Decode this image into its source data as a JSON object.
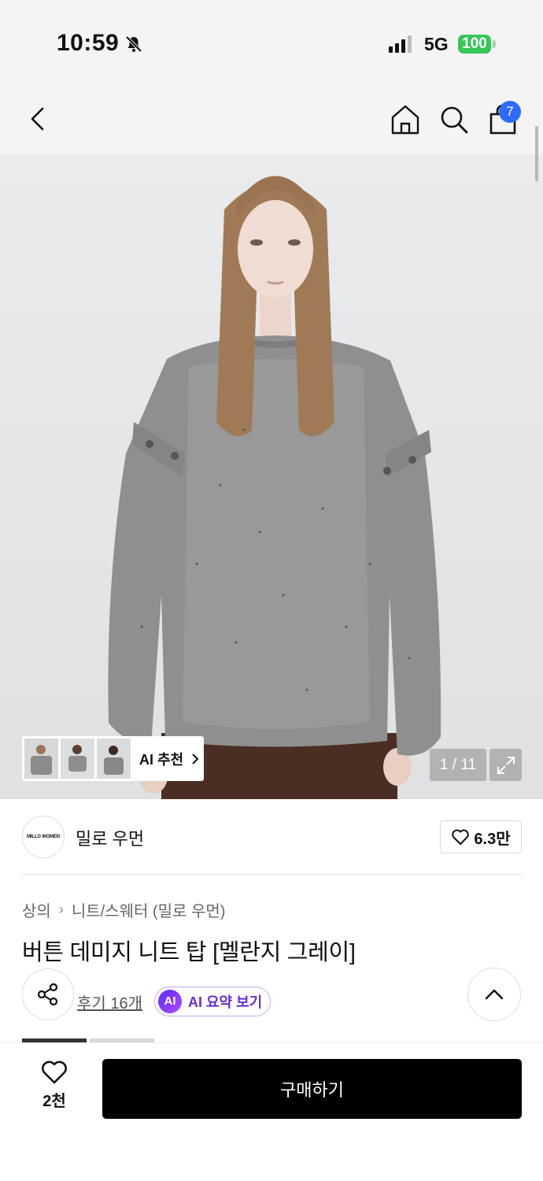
{
  "status": {
    "time": "10:59",
    "network": "5G",
    "battery": "100"
  },
  "nav": {
    "cart_count": "7"
  },
  "hero": {
    "ai_recommend_label": "AI 추천",
    "image_counter": "1 / 11"
  },
  "brand": {
    "logo_text": "MILLO WOMEN",
    "name": "밀로 우먼",
    "likes": "6.3만"
  },
  "breadcrumb": {
    "category": "상의",
    "subcategory": "니트/스웨터 (밀로 우먼)"
  },
  "product": {
    "title": "버튼 데미지 니트 탑 [멜란지 그레이]"
  },
  "actions": {
    "reviews_label": "후기 16개",
    "ai_badge": "AI",
    "ai_summary_label": "AI 요약 보기"
  },
  "bottom": {
    "wish_count": "2천",
    "buy_label": "구매하기"
  },
  "colors": {
    "accent_blue": "#2d6bff",
    "battery_green": "#35c759",
    "ai_purple": "#6a2ccf"
  }
}
